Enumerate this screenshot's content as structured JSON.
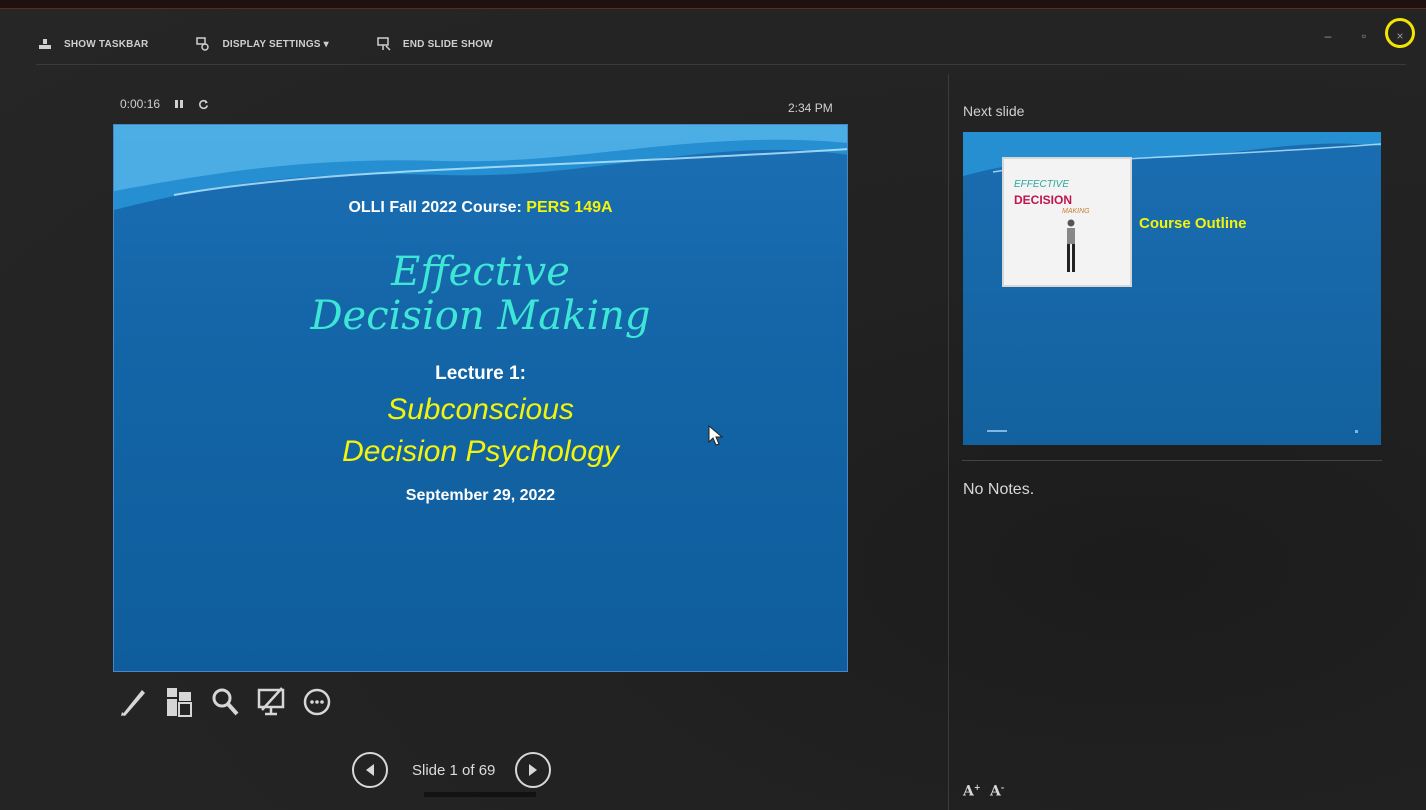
{
  "toolbar": {
    "show_taskbar": "SHOW TASKBAR",
    "display_settings": "DISPLAY SETTINGS ▾",
    "end_slide_show": "END SLIDE SHOW"
  },
  "window_controls": {
    "minimize": "‒",
    "restore": "▫",
    "close": "×"
  },
  "presenter": {
    "elapsed": "0:00:16",
    "clock": "2:34 PM"
  },
  "current_slide": {
    "course_prefix": "OLLI Fall 2022 Course:",
    "course_code": "PERS 149A",
    "title_line1": "Effective",
    "title_line2": "Decision Making",
    "lecture": "Lecture 1:",
    "subtitle_line1": "Subconscious",
    "subtitle_line2": "Decision Psychology",
    "date": "September 29, 2022"
  },
  "tools": [
    "pen-icon",
    "see-all-slides-icon",
    "zoom-icon",
    "black-screen-icon",
    "more-options-icon"
  ],
  "navigation": {
    "label": "Slide 1 of 69",
    "current": 1,
    "total": 69,
    "progress": 0.0
  },
  "next_slide": {
    "label": "Next slide",
    "title": "Course Outline",
    "book_line1": "EFFECTIVE",
    "book_line2": "DECISION",
    "book_line3": "MAKING"
  },
  "notes": {
    "text": "No Notes."
  },
  "font_controls": {
    "increase": "A",
    "decrease": "A"
  },
  "colors": {
    "slide_blue": "#1466a8",
    "accent_yellow": "#f4f40a",
    "title_cyan": "#3ee6d6",
    "highlight_ring": "#f2e600"
  }
}
